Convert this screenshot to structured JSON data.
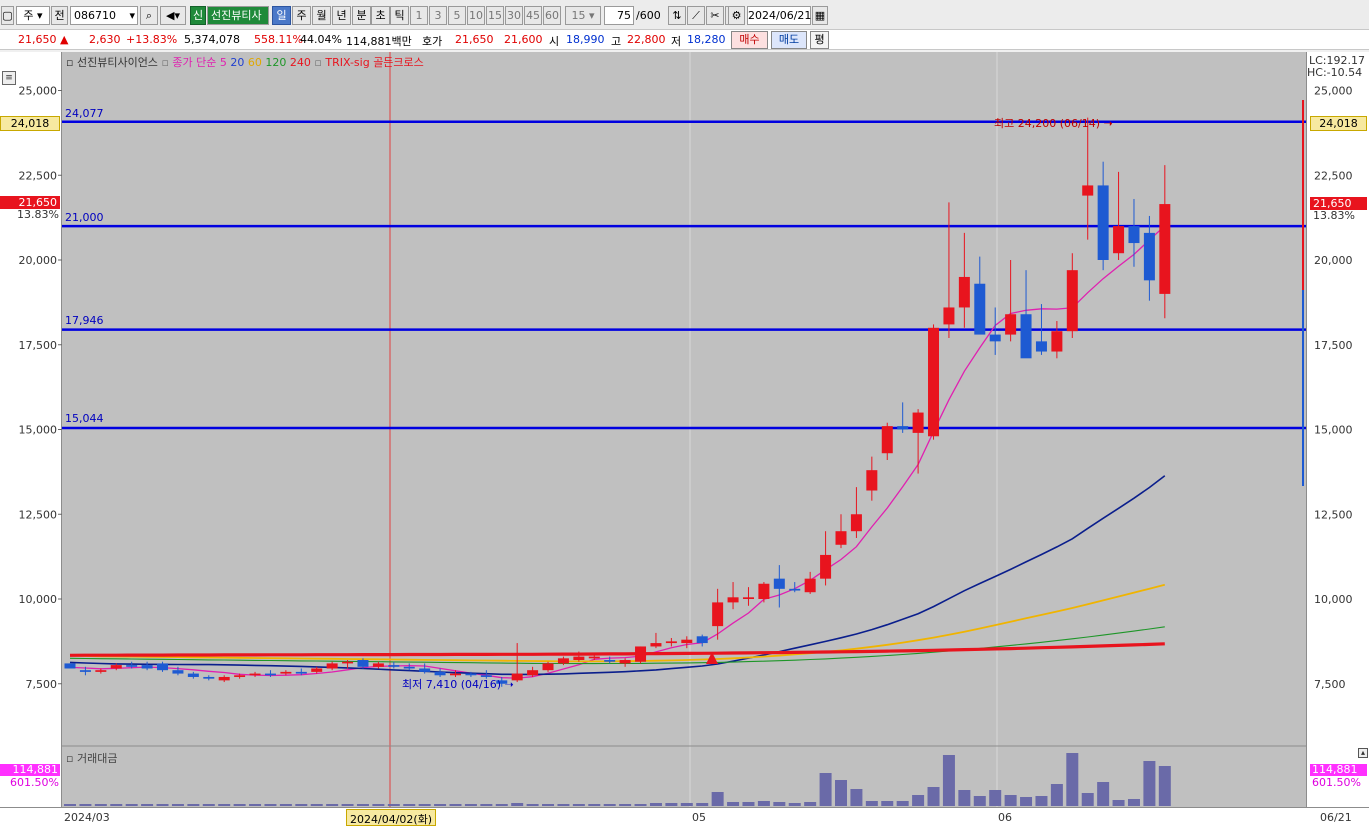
{
  "toolbar": {
    "type_label": "주",
    "mode_label": "전",
    "code": "086710",
    "badge": "신",
    "stock_name": "선진뷰티사",
    "periods": [
      "일",
      "주",
      "월",
      "년",
      "분",
      "초",
      "틱"
    ],
    "selected_period": "일",
    "intervals": [
      "1",
      "3",
      "5",
      "10",
      "15",
      "30",
      "45",
      "60"
    ],
    "interval_value": "15",
    "count_value": "75",
    "count_max": "/600",
    "date": "2024/06/21"
  },
  "quote": {
    "price": "21,650",
    "arrow": "▲",
    "change": "2,630",
    "change_pct": "+13.83%",
    "volume": "5,374,078",
    "volume_ratio": "558.11%",
    "turnover": "44.04%",
    "amount": "114,881백만",
    "ask_label": "호가",
    "ask": "21,650",
    "bid": "21,600",
    "open_label": "시",
    "open": "18,990",
    "high_label": "고",
    "high": "22,800",
    "low_label": "저",
    "low": "18,280",
    "buy_button": "매수",
    "sell_button": "매도",
    "eval_button": "평"
  },
  "legend": {
    "stock": "선진뷰티사이언스",
    "ma_label": "종가 단순 5",
    "ma20": "20",
    "ma60": "60",
    "ma120": "120",
    "ma240": "240",
    "signal": "TRIX-sig 골든크로스"
  },
  "right_header": {
    "lc": "LC:192.17",
    "hc": "HC:-10.54"
  },
  "price_axis": {
    "ticks": [
      "25,000",
      "22,500",
      "20,000",
      "17,500",
      "15,000",
      "12,500",
      "10,000",
      "7,500"
    ],
    "marker_high": "24,018",
    "marker_price": "21,650",
    "marker_pct": "13.83%"
  },
  "levels": [
    {
      "label": "24,077",
      "value": 24077
    },
    {
      "label": "21,000",
      "value": 21000
    },
    {
      "label": "17,946",
      "value": 17946
    },
    {
      "label": "15,044",
      "value": 15044
    }
  ],
  "annotations": {
    "max_label": "최고 24,200 (06/14)",
    "min_label": "최저 7,410 (04/16)"
  },
  "volume_panel": {
    "title": "거래대금",
    "value": "114,881",
    "pct": "601.50%"
  },
  "date_axis": {
    "labels": [
      "2024/03",
      "05",
      "06",
      "06/21"
    ],
    "cursor_label": "2024/04/02(화)"
  },
  "colors": {
    "up": "#e8141e",
    "down": "#1e5ad2",
    "ma5": "#e020b0",
    "ma20": "#0a1e8c",
    "ma60": "#f0b400",
    "ma120": "#1e9628",
    "ma240": "#e8141e",
    "level_line": "#0000e0",
    "volume_bar": "#6a6aa8"
  },
  "chart_data": {
    "type": "candlestick",
    "ylim": [
      6900,
      25900
    ],
    "candles": [
      [
        8100,
        8100,
        7950,
        7950
      ],
      [
        7900,
        8000,
        7750,
        7850
      ],
      [
        7850,
        7950,
        7800,
        7900
      ],
      [
        7950,
        8100,
        7900,
        8050
      ],
      [
        8050,
        8150,
        7950,
        8000
      ],
      [
        8050,
        8150,
        7900,
        7950
      ],
      [
        8100,
        8150,
        7850,
        7900
      ],
      [
        7900,
        8000,
        7750,
        7800
      ],
      [
        7800,
        7850,
        7650,
        7700
      ],
      [
        7700,
        7750,
        7600,
        7650
      ],
      [
        7600,
        7750,
        7550,
        7700
      ],
      [
        7700,
        7800,
        7650,
        7750
      ],
      [
        7750,
        7850,
        7700,
        7800
      ],
      [
        7800,
        7900,
        7700,
        7750
      ],
      [
        7800,
        7900,
        7750,
        7850
      ],
      [
        7850,
        7950,
        7750,
        7800
      ],
      [
        7850,
        8000,
        7800,
        7950
      ],
      [
        7950,
        8150,
        7900,
        8100
      ],
      [
        8100,
        8200,
        7950,
        8150
      ],
      [
        8200,
        8250,
        7950,
        8000
      ],
      [
        8000,
        8150,
        7950,
        8100
      ],
      [
        8050,
        8150,
        7950,
        8000
      ],
      [
        8000,
        8100,
        7900,
        7950
      ],
      [
        7950,
        8100,
        7800,
        7850
      ],
      [
        7850,
        7950,
        7700,
        7750
      ],
      [
        7750,
        7900,
        7700,
        7800
      ],
      [
        7800,
        7850,
        7700,
        7750
      ],
      [
        7750,
        7900,
        7650,
        7700
      ],
      [
        7600,
        7700,
        7410,
        7500
      ],
      [
        7600,
        8700,
        7550,
        7800
      ],
      [
        7750,
        8000,
        7700,
        7900
      ],
      [
        7900,
        8150,
        7850,
        8100
      ],
      [
        8100,
        8300,
        8050,
        8250
      ],
      [
        8200,
        8450,
        8150,
        8300
      ],
      [
        8250,
        8400,
        8200,
        8300
      ],
      [
        8200,
        8300,
        8100,
        8150
      ],
      [
        8100,
        8250,
        8000,
        8200
      ],
      [
        8150,
        8600,
        8100,
        8600
      ],
      [
        8600,
        9000,
        8550,
        8700
      ],
      [
        8700,
        8850,
        8600,
        8750
      ],
      [
        8700,
        8900,
        8550,
        8800
      ],
      [
        8900,
        8950,
        8600,
        8700
      ],
      [
        9200,
        10300,
        8800,
        9900
      ],
      [
        9900,
        10500,
        9700,
        10050
      ],
      [
        10000,
        10350,
        9800,
        10050
      ],
      [
        10000,
        10500,
        9900,
        10450
      ],
      [
        10600,
        11000,
        9750,
        10300
      ],
      [
        10300,
        10500,
        10200,
        10250
      ],
      [
        10200,
        10800,
        10150,
        10600
      ],
      [
        10600,
        12000,
        10400,
        11300
      ],
      [
        11600,
        12500,
        11500,
        12000
      ],
      [
        12000,
        13300,
        11800,
        12500
      ],
      [
        13200,
        14200,
        12900,
        13800
      ],
      [
        14300,
        15200,
        14100,
        15100
      ],
      [
        15100,
        15800,
        14900,
        15000
      ],
      [
        14900,
        15600,
        13700,
        15500
      ],
      [
        14800,
        18100,
        14700,
        18000
      ],
      [
        18100,
        21700,
        17700,
        18600
      ],
      [
        18600,
        20800,
        18000,
        19500
      ],
      [
        19300,
        20100,
        17900,
        17800
      ],
      [
        17800,
        18600,
        17200,
        17600
      ],
      [
        17800,
        20000,
        17600,
        18400
      ],
      [
        18400,
        19700,
        17600,
        17100
      ],
      [
        17600,
        18700,
        17200,
        17300
      ],
      [
        17300,
        18200,
        17100,
        17900
      ],
      [
        17900,
        20200,
        17700,
        19700
      ],
      [
        21900,
        24200,
        20600,
        22200
      ],
      [
        22200,
        22900,
        19700,
        20000
      ],
      [
        20200,
        22600,
        20000,
        21000
      ],
      [
        21000,
        21800,
        19800,
        20500
      ],
      [
        20800,
        21300,
        18800,
        19400
      ],
      [
        19000,
        22800,
        18280,
        21650
      ]
    ],
    "series": [
      {
        "name": "5",
        "values": [
          7981,
          7966,
          7942,
          7956,
          7973,
          7992,
          7977,
          7946,
          7912,
          7867,
          7831,
          7778,
          7756,
          7742,
          7753,
          7766,
          7803,
          7848,
          7911,
          7977,
          8011,
          8023,
          8036,
          8023,
          7953,
          7882,
          7810,
          7749,
          7677,
          7667,
          7709,
          7811,
          7934,
          8062,
          8222,
          8256,
          8270,
          8313,
          8441,
          8559,
          8658,
          8712,
          8969,
          9290,
          9588,
          9991,
          10118,
          10304,
          10553,
          10863,
          11165,
          11543,
          12126,
          12684,
          13314,
          13968,
          14934,
          15875,
          16720,
          17411,
          18067,
          18422,
          18517,
          18561,
          18552,
          18590,
          19034,
          19449,
          19813,
          20165,
          20591,
          21006
        ]
      },
      {
        "name": "20",
        "values": [
          8131,
          8113,
          8097,
          8086,
          8079,
          8075,
          8072,
          8069,
          8066,
          8064,
          8058,
          8050,
          8042,
          8032,
          8022,
          8011,
          7996,
          7983,
          7967,
          7950,
          7930,
          7909,
          7889,
          7868,
          7848,
          7826,
          7810,
          7796,
          7780,
          7776,
          7776,
          7783,
          7791,
          7808,
          7823,
          7837,
          7855,
          7881,
          7909,
          7946,
          7985,
          8024,
          8083,
          8168,
          8256,
          8349,
          8449,
          8548,
          8650,
          8750,
          8856,
          8968,
          9098,
          9242,
          9401,
          9567,
          9776,
          10010,
          10246,
          10456,
          10664,
          10873,
          11094,
          11312,
          11536,
          11777,
          12083,
          12380,
          12676,
          12972,
          13290,
          13633
        ]
      },
      {
        "name": "60",
        "values": [
          8330,
          8320,
          8310,
          8305,
          8300,
          8295,
          8290,
          8285,
          8280,
          8275,
          8270,
          8265,
          8260,
          8255,
          8250,
          8245,
          8240,
          8235,
          8230,
          8225,
          8220,
          8215,
          8210,
          8205,
          8200,
          8195,
          8190,
          8185,
          8180,
          8175,
          8170,
          8165,
          8160,
          8160,
          8160,
          8160,
          8165,
          8170,
          8180,
          8190,
          8200,
          8215,
          8230,
          8250,
          8275,
          8300,
          8330,
          8365,
          8400,
          8440,
          8485,
          8535,
          8590,
          8650,
          8715,
          8785,
          8860,
          8945,
          9035,
          9130,
          9230,
          9330,
          9430,
          9530,
          9630,
          9735,
          9845,
          9960,
          10075,
          10190,
          10305,
          10420
        ]
      },
      {
        "name": "120",
        "values": [
          8250,
          8245,
          8240,
          8235,
          8230,
          8225,
          8220,
          8215,
          8210,
          8205,
          8200,
          8195,
          8190,
          8185,
          8180,
          8175,
          8170,
          8165,
          8160,
          8155,
          8150,
          8145,
          8140,
          8135,
          8130,
          8125,
          8120,
          8115,
          8110,
          8105,
          8100,
          8098,
          8096,
          8095,
          8095,
          8096,
          8098,
          8100,
          8105,
          8110,
          8115,
          8122,
          8130,
          8140,
          8152,
          8165,
          8180,
          8196,
          8214,
          8234,
          8256,
          8280,
          8306,
          8334,
          8364,
          8396,
          8430,
          8466,
          8504,
          8544,
          8586,
          8630,
          8676,
          8724,
          8774,
          8826,
          8880,
          8936,
          8994,
          9054,
          9116,
          9180
        ]
      },
      {
        "name": "240",
        "values": [
          8340,
          8341,
          8342,
          8343,
          8344,
          8345,
          8346,
          8347,
          8348,
          8349,
          8350,
          8351,
          8352,
          8353,
          8354,
          8355,
          8356,
          8357,
          8358,
          8359,
          8360,
          8361,
          8362,
          8363,
          8364,
          8365,
          8366,
          8367,
          8368,
          8369,
          8370,
          8372,
          8374,
          8376,
          8378,
          8380,
          8382,
          8385,
          8388,
          8391,
          8394,
          8398,
          8402,
          8406,
          8410,
          8415,
          8420,
          8425,
          8430,
          8436,
          8442,
          8448,
          8455,
          8462,
          8470,
          8478,
          8487,
          8496,
          8506,
          8516,
          8527,
          8538,
          8550,
          8562,
          8575,
          8588,
          8602,
          8616,
          8631,
          8646,
          8662,
          8678
        ]
      }
    ],
    "volume": [
      2,
      2,
      2,
      2,
      2,
      2,
      2,
      2,
      2,
      2,
      2,
      2,
      2,
      2,
      2,
      2,
      2,
      2,
      2,
      2,
      2,
      2,
      2,
      2,
      2,
      2,
      2,
      2,
      2,
      3,
      2,
      2,
      2,
      2,
      2,
      2,
      2,
      2,
      3,
      3,
      3,
      3,
      14,
      4,
      4,
      5,
      4,
      3,
      4,
      33,
      26,
      17,
      5,
      5,
      5,
      11,
      19,
      51,
      16,
      10,
      16,
      11,
      9,
      10,
      22,
      53,
      13,
      24,
      6,
      7,
      45,
      40
    ]
  }
}
